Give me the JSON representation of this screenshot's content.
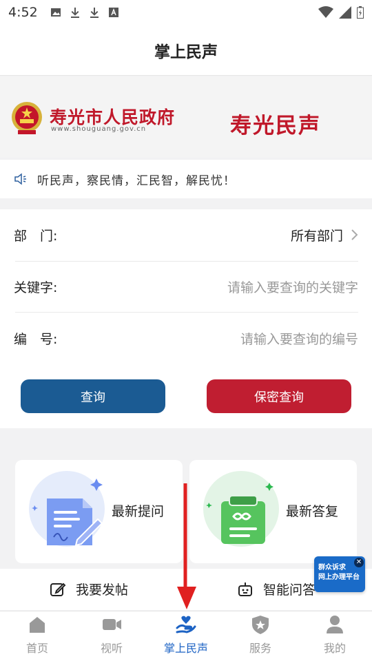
{
  "status_bar": {
    "time": "4:52"
  },
  "header": {
    "title": "掌上民声"
  },
  "banner": {
    "gov_name": "寿光市人民政府",
    "gov_url": "www.shouguang.gov.cn",
    "brand": "寿光民声"
  },
  "notice": {
    "text": "听民声，察民情，汇民智，解民忧！"
  },
  "form": {
    "department_label": "部　门:",
    "department_value": "所有部门",
    "keyword_label": "关键字:",
    "keyword_placeholder": "请输入要查询的关键字",
    "number_label": "编　号:",
    "number_placeholder": "请输入要查询的编号",
    "query_button": "查询",
    "secret_query_button": "保密查询"
  },
  "cards": {
    "latest_questions": "最新提问",
    "latest_answers": "最新答复"
  },
  "actions": {
    "post": "我要发帖",
    "ai_qa": "智能问答"
  },
  "float_badge": {
    "line1": "群众诉求",
    "line2": "网上办理平台"
  },
  "colors": {
    "brand_red": "#c0182a",
    "primary_blue": "#1b5b93",
    "active_tab": "#1d63c4"
  },
  "tabs": [
    {
      "label": "首页",
      "icon": "home-icon"
    },
    {
      "label": "视听",
      "icon": "video-icon"
    },
    {
      "label": "掌上民声",
      "icon": "heart-hand-icon",
      "active": true
    },
    {
      "label": "服务",
      "icon": "shield-star-icon"
    },
    {
      "label": "我的",
      "icon": "user-icon"
    }
  ]
}
